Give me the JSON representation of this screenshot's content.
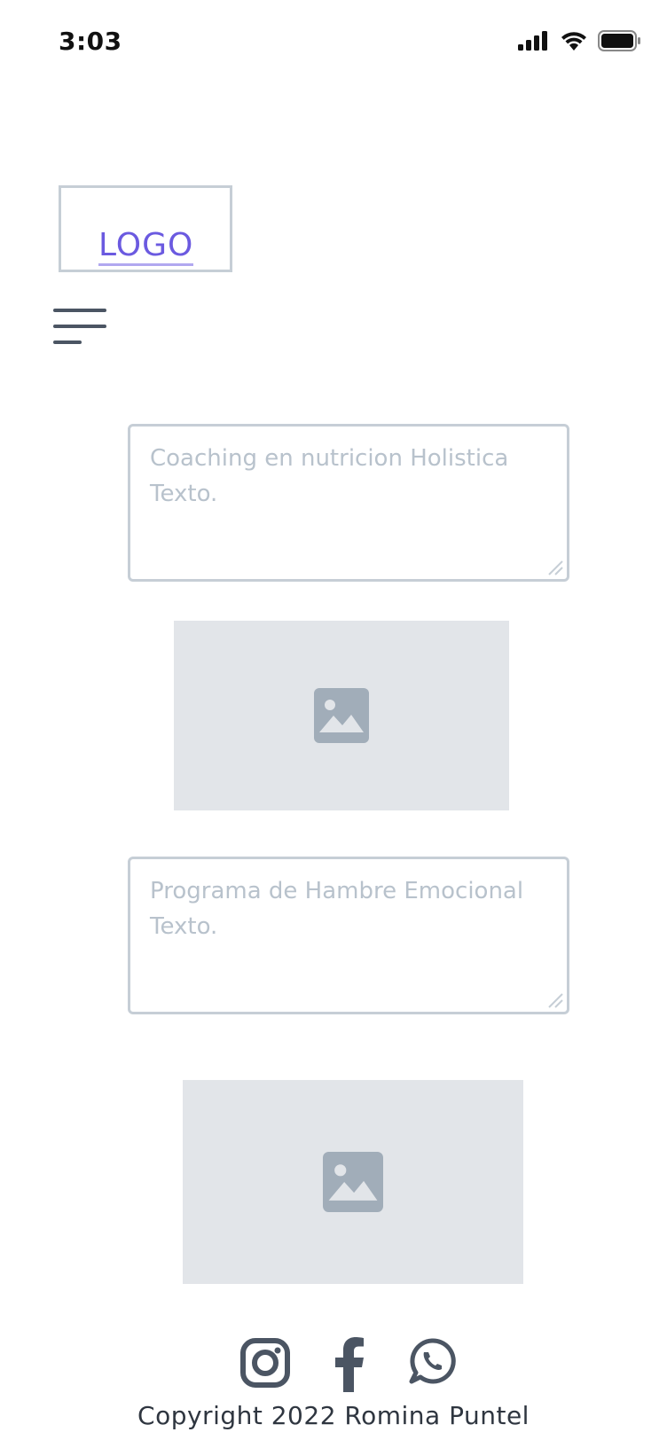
{
  "status_bar": {
    "time": "3:03",
    "icons": [
      "cellular-signal-icon",
      "wifi-icon",
      "battery-icon"
    ]
  },
  "header": {
    "logo_text": "LOGO",
    "menu_icon": "hamburger-menu-icon"
  },
  "sections": [
    {
      "title": "Coaching en nutricion Holistica",
      "body": "Texto.",
      "image_icon": "image-placeholder-icon"
    },
    {
      "title": "Programa de Hambre Emocional",
      "body": "Texto.",
      "image_icon": "image-placeholder-icon"
    }
  ],
  "footer": {
    "social_icons": [
      "instagram-icon",
      "facebook-icon",
      "whatsapp-icon"
    ],
    "copyright": "Copyright 2022 Romina Puntel"
  },
  "colors": {
    "accent": "#6b5ae0",
    "border": "#c6ced6",
    "placeholder_text": "#b8c2cc",
    "image_bg": "#e2e5e9",
    "image_icon": "#a1adb9",
    "icon_dark": "#4b5563"
  }
}
